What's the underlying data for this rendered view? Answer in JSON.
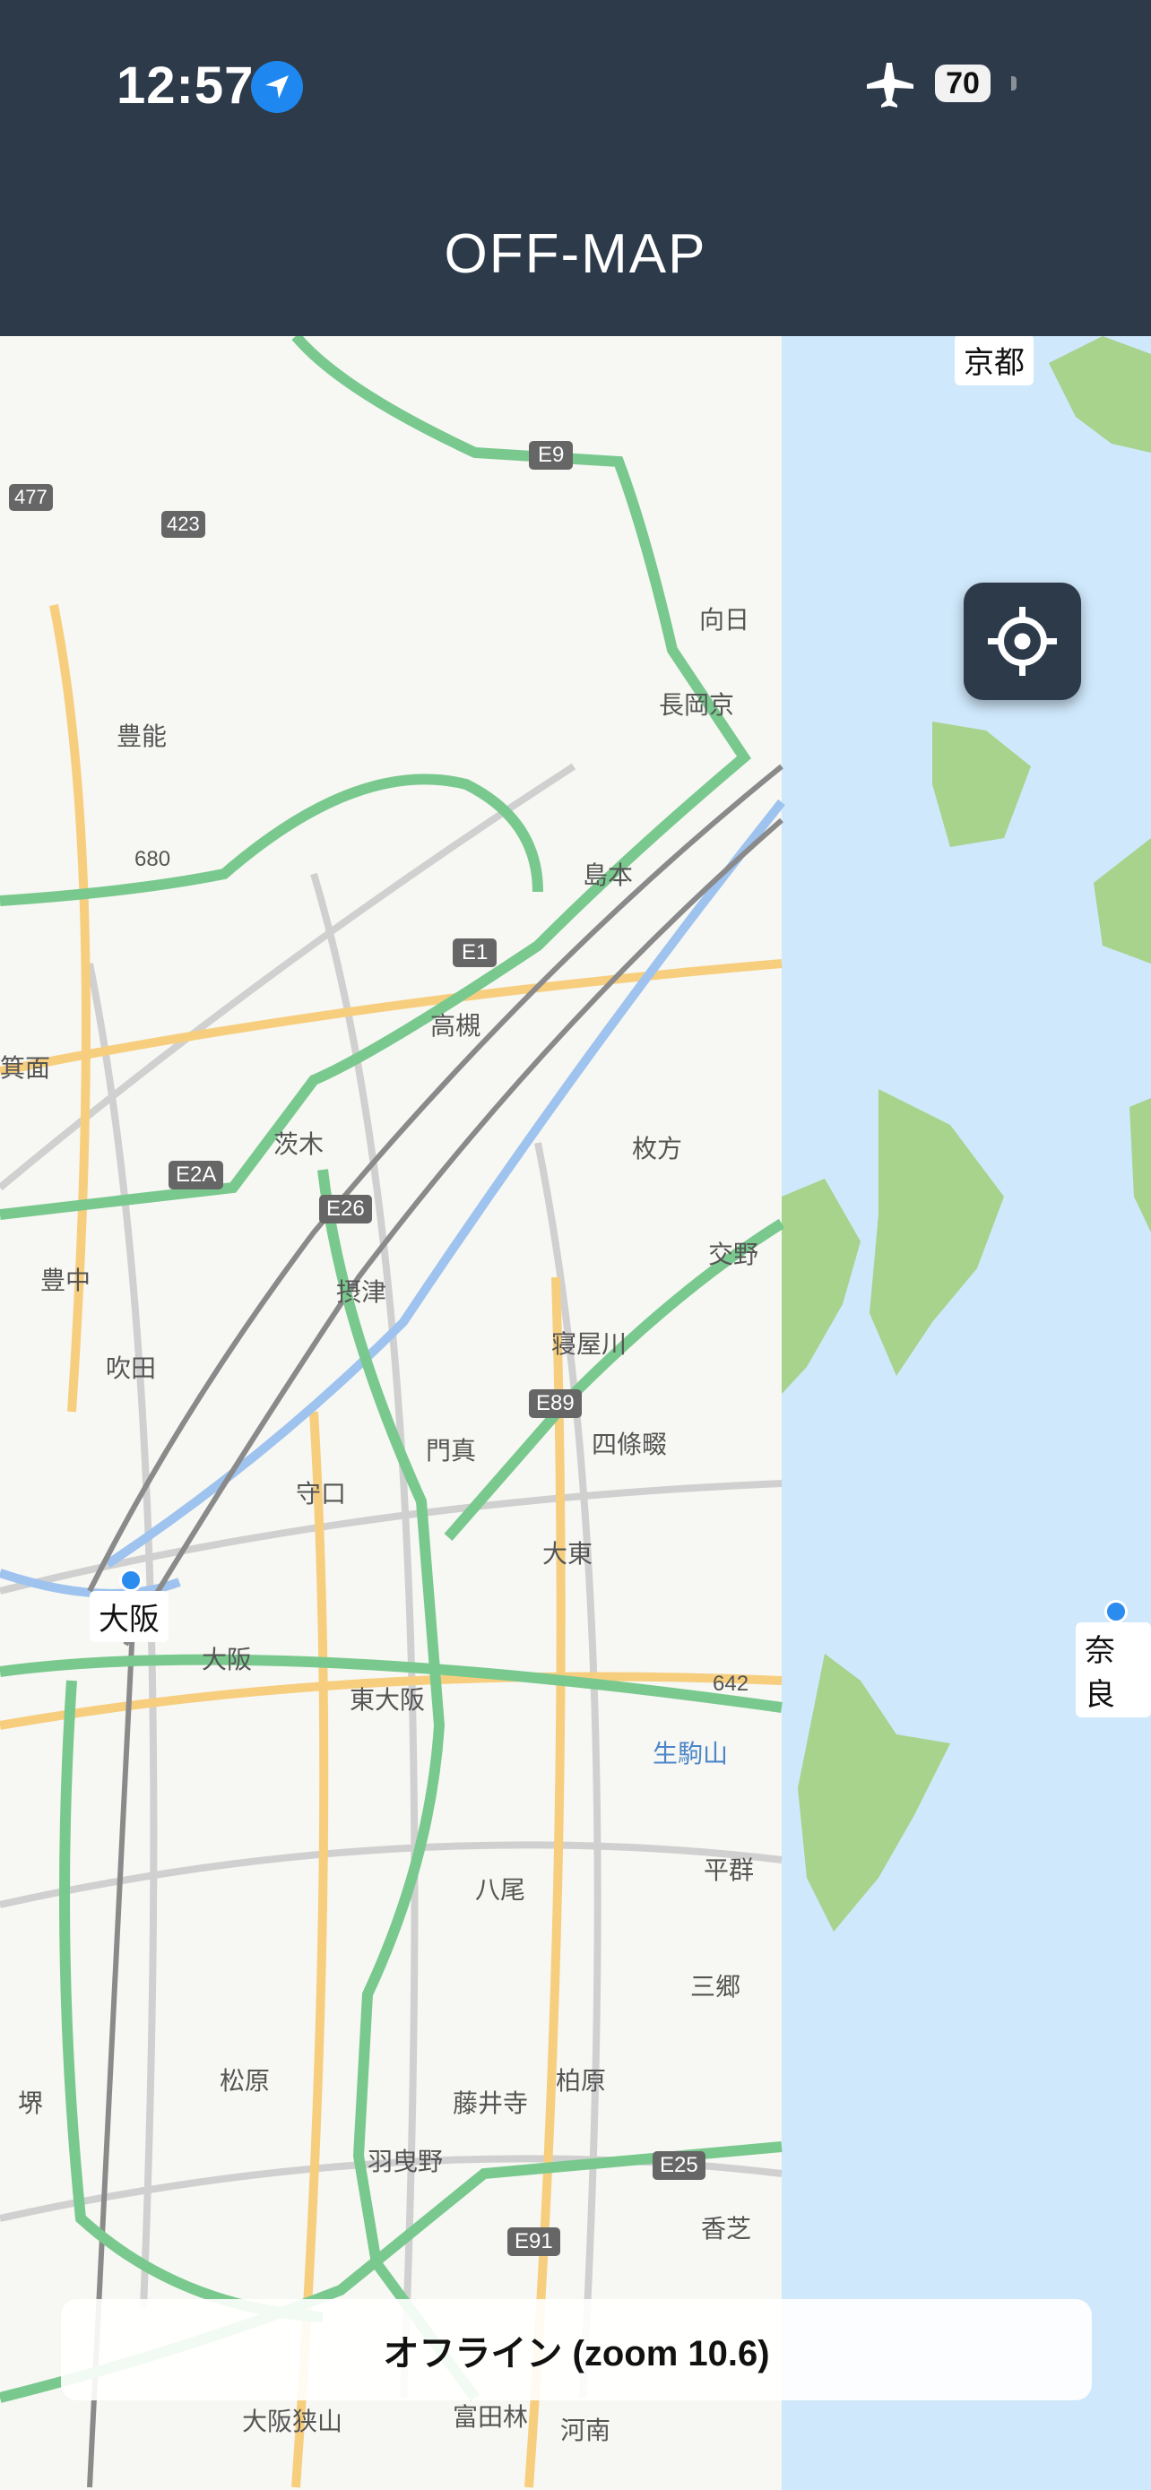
{
  "status_bar": {
    "time": "12:57",
    "battery": "70",
    "icons": [
      "location-arrow-icon",
      "airplane-mode-icon",
      "battery-icon"
    ]
  },
  "app": {
    "title": "OFF-MAP"
  },
  "map": {
    "place_labels": [
      "京都",
      "豊能",
      "向日",
      "長岡京",
      "島本",
      "高槻",
      "箕面",
      "茨木",
      "枚方",
      "豊中",
      "摂津",
      "交野",
      "吹田",
      "寝屋川",
      "門真",
      "四條畷",
      "守口",
      "大東",
      "大阪",
      "東大阪",
      "生駒山",
      "八尾",
      "平群",
      "三郷",
      "松原",
      "柏原",
      "藤井寺",
      "羽曳野",
      "堺",
      "香芝",
      "大阪狭山",
      "富田林",
      "河南",
      "奈良"
    ],
    "road_labels": [
      "E9",
      "E1",
      "E2A",
      "E26",
      "E89",
      "E25",
      "E91",
      "477",
      "423"
    ],
    "elevation_labels": [
      "680",
      "642"
    ],
    "city_labels": {
      "kyoto": "京都",
      "osaka": "大阪",
      "nara": "奈良"
    },
    "colors": {
      "water": "#cfe8fb",
      "land": "#f7f7f3",
      "park": "#a7d38c",
      "highway": "#79c98e",
      "major_road": "#f7ce7e",
      "rail": "#8a8a8a"
    }
  },
  "controls": {
    "locate_icon": "crosshair-icon"
  },
  "zoom_indicator": {
    "text": "オフライン (zoom 10.6)"
  }
}
